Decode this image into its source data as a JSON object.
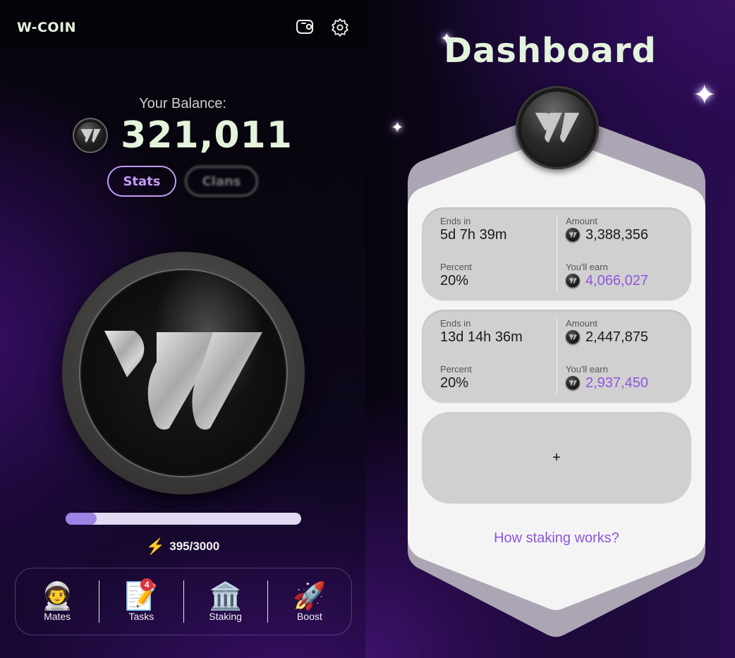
{
  "left": {
    "brand": "W-COIN",
    "icons": {
      "wallet": "wallet-icon",
      "settings": "gear-icon"
    },
    "balance_label": "Your Balance:",
    "balance_value": "321,011",
    "tabs": [
      {
        "label": "Stats",
        "active": true
      },
      {
        "label": "Clans",
        "active": false
      }
    ],
    "energy": {
      "current": 395,
      "max": 3000,
      "text": "395/3000",
      "fraction": 0.1317
    },
    "nav": [
      {
        "label": "Mates",
        "emoji": "👨‍🚀",
        "icon": "astronaut-icon"
      },
      {
        "label": "Tasks",
        "emoji": "📝",
        "icon": "memo-icon",
        "badge": "4"
      },
      {
        "label": "Staking",
        "emoji": "🏛️",
        "icon": "bank-icon"
      },
      {
        "label": "Boost",
        "emoji": "🚀",
        "icon": "rocket-icon"
      }
    ]
  },
  "right": {
    "title": "Dashboard",
    "stakes": [
      {
        "ends_label": "Ends in",
        "ends_value": "5d 7h 39m",
        "percent_label": "Percent",
        "percent_value": "20%",
        "amount_label": "Amount",
        "amount_value": "3,388,356",
        "earn_label": "You'll earn",
        "earn_value": "4,066,027"
      },
      {
        "ends_label": "Ends in",
        "ends_value": "13d 14h 36m",
        "percent_label": "Percent",
        "percent_value": "20%",
        "amount_label": "Amount",
        "amount_value": "2,447,875",
        "earn_label": "You'll earn",
        "earn_value": "2,937,450"
      }
    ],
    "add_label": "+",
    "how_link": "How staking works?"
  },
  "colors": {
    "accent_purple": "#8e55e0",
    "tab_active": "#c39bf5",
    "mint_text": "#e3f3dc",
    "progress_fill": "#9c84e4",
    "progress_track": "#e1daf2",
    "badge_red": "#d8333f"
  }
}
